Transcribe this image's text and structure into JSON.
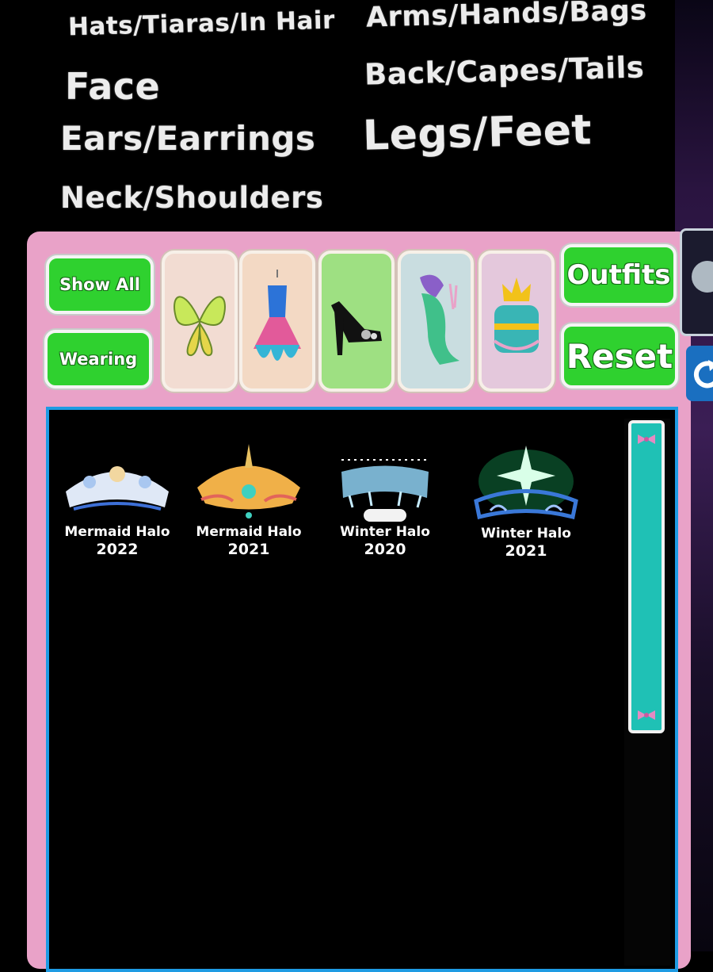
{
  "categories": {
    "hats": "Hats/Tiaras/In Hair",
    "face": "Face",
    "ears": "Ears/Earrings",
    "neck": "Neck/Shoulders",
    "arms": "Arms/Hands/Bags",
    "back": "Back/Capes/Tails",
    "legs": "Legs/Feet"
  },
  "buttons": {
    "show_all": "Show All",
    "wearing": "Wearing",
    "outfits": "Outfits",
    "reset": "Reset"
  },
  "tabs": [
    {
      "icon": "fairy-wings-icon",
      "bg": "#f2dcd2"
    },
    {
      "icon": "dress-icon",
      "bg": "#f3d9c4"
    },
    {
      "icon": "high-heel-shoe-icon",
      "bg": "#9ee082"
    },
    {
      "icon": "mermaid-tail-icon",
      "bg": "#c9dde0"
    },
    {
      "icon": "crown-chest-icon",
      "bg": "#e4c8dc"
    }
  ],
  "items": [
    {
      "name": "Mermaid Halo",
      "year": "2022",
      "icon": "mermaid-halo-crown-icon"
    },
    {
      "name": "Mermaid Halo",
      "year": "2021",
      "icon": "golden-mermaid-halo-icon"
    },
    {
      "name": "Winter Halo",
      "year": "2020",
      "icon": "icy-winter-halo-icon"
    },
    {
      "name": "Winter Halo",
      "year": "2021",
      "icon": "green-star-winter-halo-icon"
    }
  ],
  "colors": {
    "panel": "#e9a2c8",
    "button_green": "#2fd12f",
    "grid_border": "#1e9be3",
    "scrollbar": "#1fc1b5"
  }
}
